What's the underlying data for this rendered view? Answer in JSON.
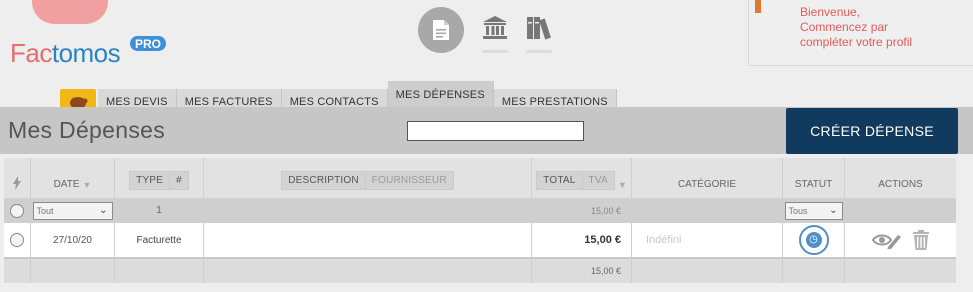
{
  "brand": {
    "part1": "Fac",
    "part2": "tomos",
    "badge": "PRO"
  },
  "top_icons": [
    "document-icon",
    "bank-icon",
    "books-icon"
  ],
  "welcome": {
    "line1": "Bienvenue,",
    "line2": "Commencez par",
    "line3": "compléter votre profil"
  },
  "tabs": [
    {
      "label": "MES DEVIS"
    },
    {
      "label": "MES FACTURES"
    },
    {
      "label": "MES CONTACTS"
    },
    {
      "label": "MES DÉPENSES",
      "active": true
    },
    {
      "label": "MES PRESTATIONS"
    }
  ],
  "page": {
    "title": "Mes Dépenses",
    "search_value": "",
    "create_label": "CRÉER DÉPENSE"
  },
  "table": {
    "headers": {
      "date": "DATE",
      "type": "TYPE",
      "type_sort": "#",
      "description": "DESCRIPTION",
      "fournisseur": "FOURNISSEUR",
      "total": "TOTAL",
      "tva": "TVA",
      "categorie": "CATÉGORIE",
      "statut": "STATUT",
      "actions": "ACTIONS"
    },
    "filters": {
      "date": "Tout",
      "type_count": "1",
      "total": "15,00 €",
      "statut": "Tous"
    },
    "rows": [
      {
        "date": "27/10/20",
        "type": "Facturette",
        "total": "15,00 €",
        "categorie": "Indéfini"
      }
    ],
    "footer": {
      "total": "15,00 €"
    }
  },
  "colors": {
    "accent": "#103a5e",
    "brand_red": "#e36f6f",
    "brand_blue": "#2c83c4",
    "tab_home": "#f2b817",
    "status": "#4f8fc9"
  }
}
